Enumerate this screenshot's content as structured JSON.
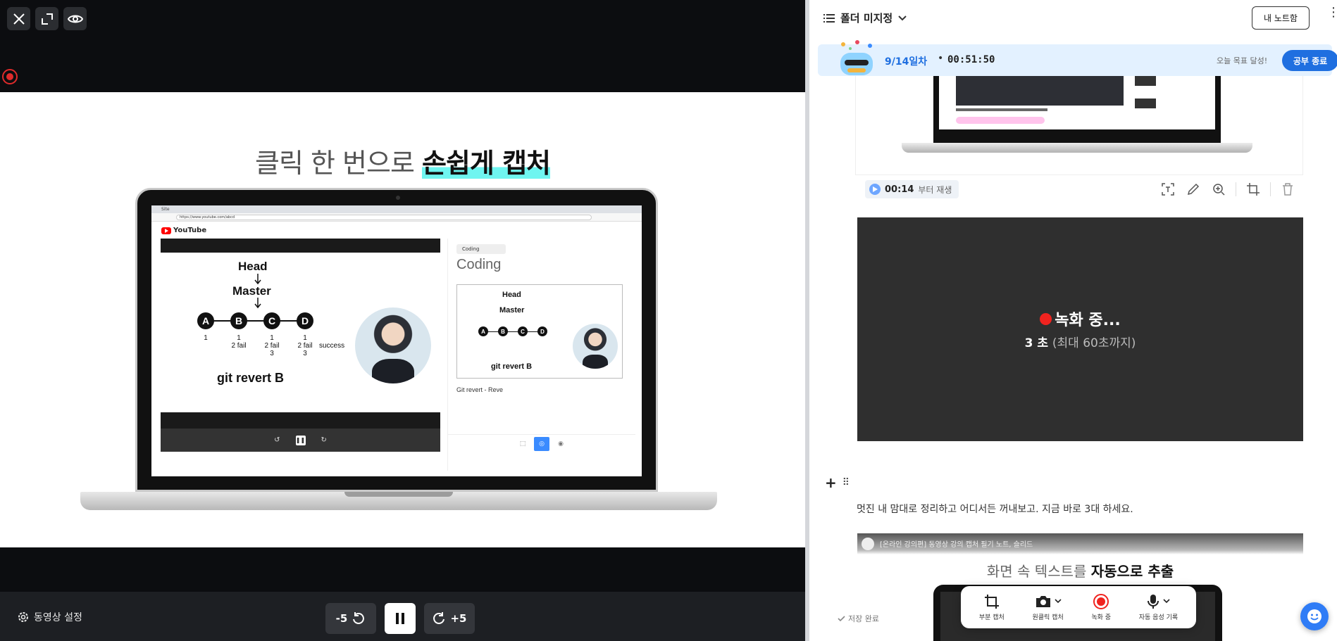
{
  "player": {
    "slide_title_plain": "클릭 한 번으로 ",
    "slide_title_highlight": "손쉽게 캡처",
    "browser_tab": "Site",
    "browser_url": "https://www.youtube.com/abcd",
    "youtube_label": "YouTube",
    "inner_slide": {
      "head": "Head",
      "master": "Master",
      "nodes": [
        "A",
        "B",
        "C",
        "D"
      ],
      "fail_labels": [
        "1",
        "1\n2 fail",
        "1\n2 fail\n3",
        "1\n2 fail\n3"
      ],
      "success": "success",
      "caption": "git revert B"
    },
    "notes_panel": {
      "tag": "Coding",
      "title": "Coding",
      "note": "Git revert - Reve"
    },
    "controls": {
      "settings_label": "동영상 설정",
      "rewind_label": "-5",
      "forward_label": "+5"
    }
  },
  "notes": {
    "folder_label": "폴더 미지정",
    "my_notes_button": "내 노트함",
    "study": {
      "day": "9/14일차",
      "dot": "•",
      "timer": "00:51:50",
      "goal_text": "오늘 목표 달성!",
      "end_button": "공부 종료"
    },
    "capture": {
      "play_time": "00:14",
      "play_suffix": "부터 재생"
    },
    "recording": {
      "title": "녹화 중...",
      "seconds": "3 초",
      "limit": "(최대 60초까지)"
    },
    "note_line": "멋진 내 맘대로 정리하고 어디서든 꺼내보고. 지금 바로 3대 하세요.",
    "clip": {
      "header": "[온라인 강의편] 동영상 강의 캡처 필기 노트, 슬리드",
      "title_plain": "화면 속 텍스트를 ",
      "title_bold": "자동으로 추출"
    },
    "floating_bar": {
      "partial_capture": "부분 캡처",
      "one_click_capture": "원클릭 캡처",
      "recording": "녹화 중",
      "auto_voice": "자동 음성 기록"
    },
    "saved_label": "저장 완료"
  },
  "colors": {
    "accent_blue": "#1f6fe0",
    "record_red": "#f0231f",
    "highlight_cyan": "#6ff5f0",
    "rec_box_bg": "#2f2f2f"
  }
}
